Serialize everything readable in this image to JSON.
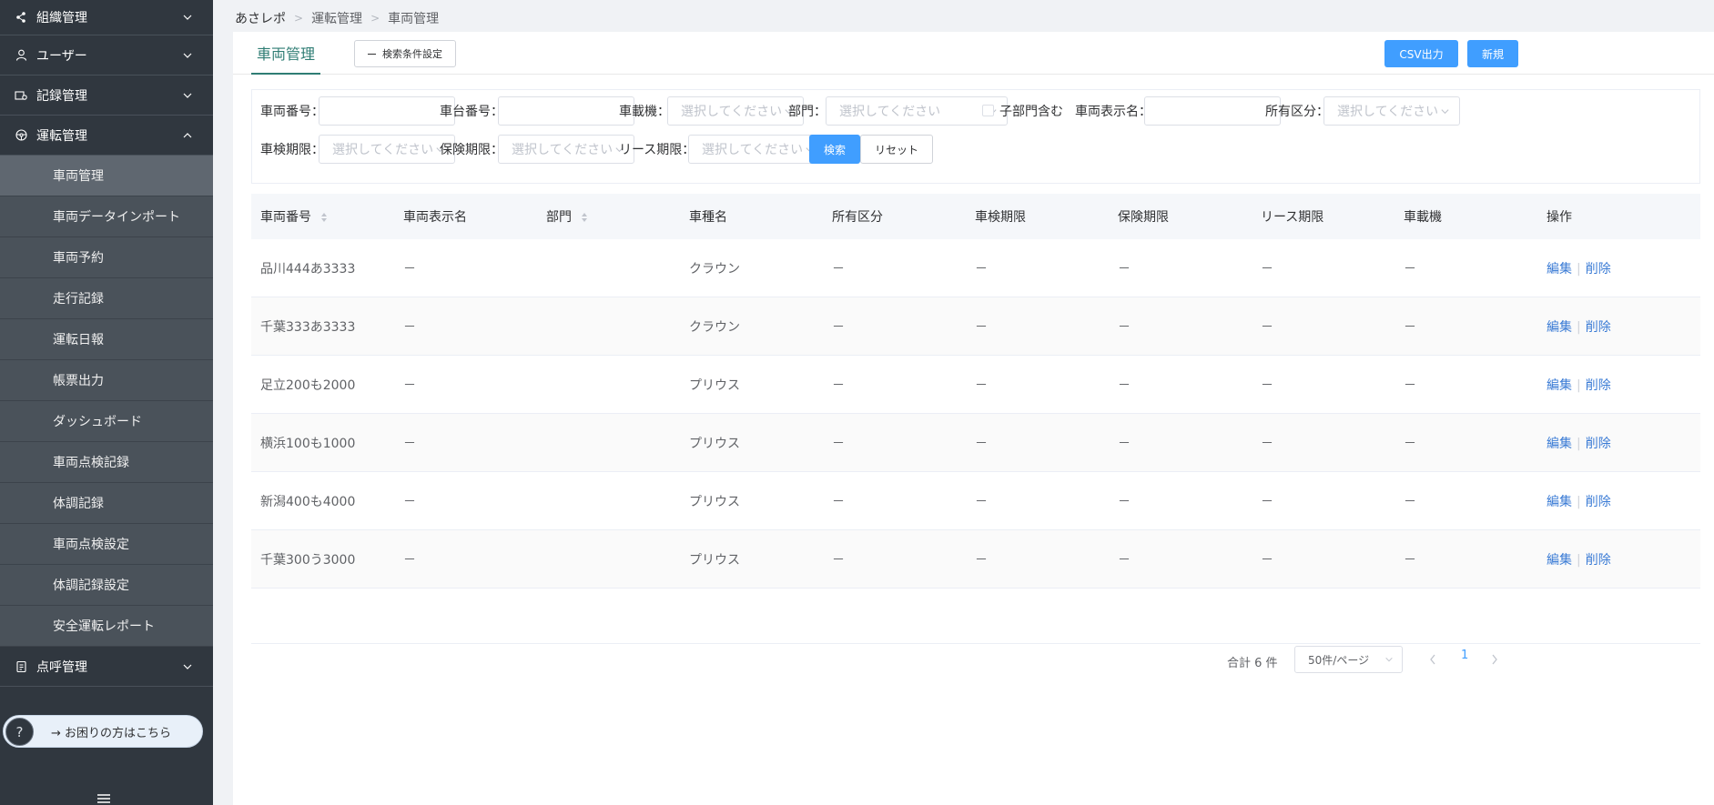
{
  "sidebar": {
    "groups": [
      {
        "label": "組織管理",
        "icon": "share-icon"
      },
      {
        "label": "ユーザー",
        "icon": "user-icon"
      },
      {
        "label": "記録管理",
        "icon": "record-icon"
      },
      {
        "label": "運転管理",
        "icon": "steering-wheel-icon"
      },
      {
        "label": "点呼管理",
        "icon": "clipboard-icon"
      }
    ],
    "sub_items": [
      {
        "label": "車両管理",
        "active": true
      },
      {
        "label": "車両データインポート"
      },
      {
        "label": "車両予約"
      },
      {
        "label": "走行記録"
      },
      {
        "label": "運転日報"
      },
      {
        "label": "帳票出力"
      },
      {
        "label": "ダッシュボード"
      },
      {
        "label": "車両点検記録"
      },
      {
        "label": "体調記録"
      },
      {
        "label": "車両点検設定"
      },
      {
        "label": "体調記録設定"
      },
      {
        "label": "安全運転レポート"
      }
    ],
    "help": {
      "label": "→ お困りの方はこちら",
      "circle": "?"
    }
  },
  "breadcrumb": [
    "あさレポ",
    "運転管理",
    "車両管理"
  ],
  "header": {
    "title": "車両管理",
    "cond_button": "検索条件設定",
    "csv_button": "CSV出力",
    "new_button": "新規"
  },
  "filters": {
    "vehicle_no": "車両番号：",
    "chassis_no": "車台番号：",
    "onboard": "車載機：",
    "dept": "部門：",
    "include_sub": "子部門含む",
    "display_name": "車両表示名：",
    "ownership": "所有区分：",
    "inspection": "車検期限：",
    "insurance": "保険期限：",
    "lease": "リース期限：",
    "placeholder": "選択してください",
    "search": "検索",
    "reset": "リセット"
  },
  "table": {
    "headers": [
      "車両番号",
      "車両表示名",
      "部門",
      "車種名",
      "所有区分",
      "車検期限",
      "保険期限",
      "リース期限",
      "車載機",
      "操作"
    ],
    "rows": [
      [
        "品川444あ3333",
        "－",
        "",
        "クラウン",
        "－",
        "－",
        "－",
        "－",
        "－"
      ],
      [
        "千葉333あ3333",
        "－",
        "",
        "クラウン",
        "－",
        "－",
        "－",
        "－",
        "－"
      ],
      [
        "足立200も2000",
        "－",
        "",
        "プリウス",
        "－",
        "－",
        "－",
        "－",
        "－"
      ],
      [
        "横浜100も1000",
        "－",
        "",
        "プリウス",
        "－",
        "－",
        "－",
        "－",
        "－"
      ],
      [
        "新潟400も4000",
        "－",
        "",
        "プリウス",
        "－",
        "－",
        "－",
        "－",
        "－"
      ],
      [
        "千葉300う3000",
        "－",
        "",
        "プリウス",
        "－",
        "－",
        "－",
        "－",
        "－"
      ]
    ],
    "edit": "編集",
    "delete": "削除"
  },
  "pagination": {
    "total": "合計 6 件",
    "page_size": "50件/ページ",
    "current_page": "1"
  }
}
